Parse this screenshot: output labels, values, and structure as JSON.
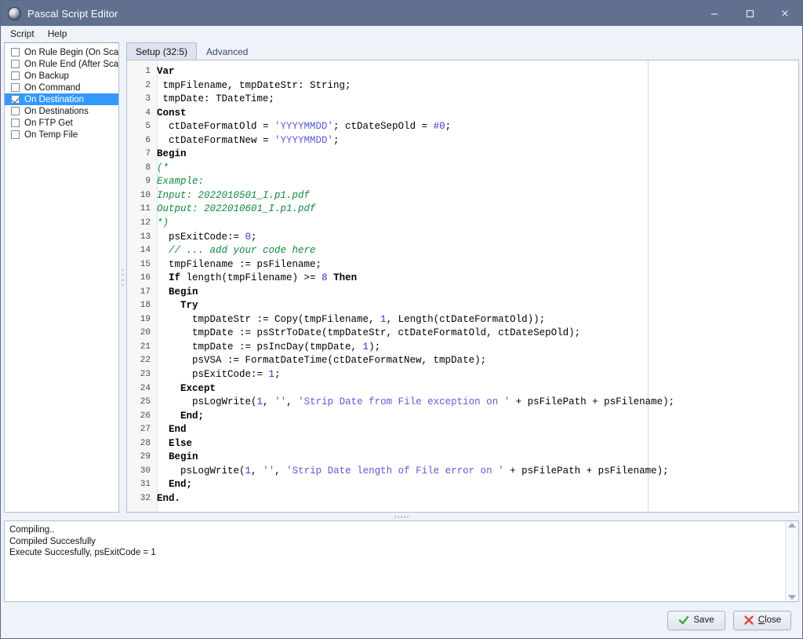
{
  "window": {
    "title": "Pascal Script Editor",
    "icon": "app-globe-icon",
    "controls": {
      "minimize": "minimize-icon",
      "maximize": "maximize-icon",
      "close": "close-icon"
    },
    "titlebar_color": "#5f718f"
  },
  "menubar": {
    "items": [
      {
        "label": "Script"
      },
      {
        "label": "Help"
      }
    ]
  },
  "sidebar": {
    "items": [
      {
        "label": "On Rule Begin (On Scan)",
        "checked": false,
        "selected": false
      },
      {
        "label": "On Rule End (After Scan)",
        "checked": false,
        "selected": false
      },
      {
        "label": "On Backup",
        "checked": false,
        "selected": false
      },
      {
        "label": "On Command",
        "checked": false,
        "selected": false
      },
      {
        "label": "On Destination",
        "checked": true,
        "selected": true
      },
      {
        "label": "On Destinations",
        "checked": false,
        "selected": false
      },
      {
        "label": "On FTP Get",
        "checked": false,
        "selected": false
      },
      {
        "label": "On Temp File",
        "checked": false,
        "selected": false
      }
    ],
    "selection_color": "#3399ff"
  },
  "tabs": [
    {
      "label": "Setup (32:5)",
      "active": true
    },
    {
      "label": "Advanced",
      "active": false
    }
  ],
  "editor": {
    "language": "pascal",
    "cursor_position": "32:5",
    "total_lines": 32,
    "colors": {
      "keyword": "#000000",
      "string": "#5b5bd6",
      "number": "#3333cc",
      "comment": "#118a3d"
    },
    "lines": [
      {
        "n": 1,
        "tokens": [
          {
            "t": "Var",
            "c": "kw"
          }
        ]
      },
      {
        "n": 2,
        "tokens": [
          {
            "t": " tmpFilename, tmpDateStr: String;",
            "c": "pln"
          }
        ]
      },
      {
        "n": 3,
        "tokens": [
          {
            "t": " tmpDate: TDateTime;",
            "c": "pln"
          }
        ]
      },
      {
        "n": 4,
        "tokens": [
          {
            "t": "Const",
            "c": "kw"
          }
        ]
      },
      {
        "n": 5,
        "tokens": [
          {
            "t": "  ctDateFormatOld = ",
            "c": "pln"
          },
          {
            "t": "'YYYYMMDD'",
            "c": "str"
          },
          {
            "t": "; ctDateSepOld = ",
            "c": "pln"
          },
          {
            "t": "#0",
            "c": "num"
          },
          {
            "t": ";",
            "c": "pln"
          }
        ]
      },
      {
        "n": 6,
        "tokens": [
          {
            "t": "  ctDateFormatNew = ",
            "c": "pln"
          },
          {
            "t": "'YYYYMMDD'",
            "c": "str"
          },
          {
            "t": ";",
            "c": "pln"
          }
        ]
      },
      {
        "n": 7,
        "tokens": [
          {
            "t": "Begin",
            "c": "kw"
          }
        ]
      },
      {
        "n": 8,
        "tokens": [
          {
            "t": "(*",
            "c": "cmt"
          }
        ]
      },
      {
        "n": 9,
        "tokens": [
          {
            "t": "Example:",
            "c": "cmt"
          }
        ]
      },
      {
        "n": 10,
        "tokens": [
          {
            "t": "Input: 2022010501_I.p1.pdf",
            "c": "cmt"
          }
        ]
      },
      {
        "n": 11,
        "tokens": [
          {
            "t": "Output: 2022010601_I.p1.pdf",
            "c": "cmt"
          }
        ]
      },
      {
        "n": 12,
        "tokens": [
          {
            "t": "*)",
            "c": "cmt"
          }
        ]
      },
      {
        "n": 13,
        "tokens": [
          {
            "t": "  psExitCode:= ",
            "c": "pln"
          },
          {
            "t": "0",
            "c": "num"
          },
          {
            "t": ";",
            "c": "pln"
          }
        ]
      },
      {
        "n": 14,
        "tokens": [
          {
            "t": "  // ... add your code here",
            "c": "cmt"
          }
        ]
      },
      {
        "n": 15,
        "tokens": [
          {
            "t": "  tmpFilename := psFilename;",
            "c": "pln"
          }
        ]
      },
      {
        "n": 16,
        "tokens": [
          {
            "t": "  ",
            "c": "pln"
          },
          {
            "t": "If",
            "c": "kw"
          },
          {
            "t": " length(tmpFilename) >= ",
            "c": "pln"
          },
          {
            "t": "8",
            "c": "num"
          },
          {
            "t": " ",
            "c": "pln"
          },
          {
            "t": "Then",
            "c": "kw"
          }
        ]
      },
      {
        "n": 17,
        "tokens": [
          {
            "t": "  ",
            "c": "pln"
          },
          {
            "t": "Begin",
            "c": "kw"
          }
        ]
      },
      {
        "n": 18,
        "tokens": [
          {
            "t": "    ",
            "c": "pln"
          },
          {
            "t": "Try",
            "c": "kw"
          }
        ]
      },
      {
        "n": 19,
        "tokens": [
          {
            "t": "      tmpDateStr := Copy(tmpFilename, ",
            "c": "pln"
          },
          {
            "t": "1",
            "c": "num"
          },
          {
            "t": ", Length(ctDateFormatOld));",
            "c": "pln"
          }
        ]
      },
      {
        "n": 20,
        "tokens": [
          {
            "t": "      tmpDate := psStrToDate(tmpDateStr, ctDateFormatOld, ctDateSepOld);",
            "c": "pln"
          }
        ]
      },
      {
        "n": 21,
        "tokens": [
          {
            "t": "      tmpDate := psIncDay(tmpDate, ",
            "c": "pln"
          },
          {
            "t": "1",
            "c": "num"
          },
          {
            "t": ");",
            "c": "pln"
          }
        ]
      },
      {
        "n": 22,
        "tokens": [
          {
            "t": "      psVSA := FormatDateTime(ctDateFormatNew, tmpDate);",
            "c": "pln"
          }
        ]
      },
      {
        "n": 23,
        "tokens": [
          {
            "t": "      psExitCode:= ",
            "c": "pln"
          },
          {
            "t": "1",
            "c": "num"
          },
          {
            "t": ";",
            "c": "pln"
          }
        ]
      },
      {
        "n": 24,
        "tokens": [
          {
            "t": "    ",
            "c": "pln"
          },
          {
            "t": "Except",
            "c": "kw"
          }
        ]
      },
      {
        "n": 25,
        "tokens": [
          {
            "t": "      psLogWrite(",
            "c": "pln"
          },
          {
            "t": "1",
            "c": "num"
          },
          {
            "t": ", ",
            "c": "pln"
          },
          {
            "t": "''",
            "c": "str"
          },
          {
            "t": ", ",
            "c": "pln"
          },
          {
            "t": "'Strip Date from File exception on '",
            "c": "str"
          },
          {
            "t": " + psFilePath + psFilename);",
            "c": "pln"
          }
        ]
      },
      {
        "n": 26,
        "tokens": [
          {
            "t": "    ",
            "c": "pln"
          },
          {
            "t": "End;",
            "c": "kw"
          }
        ]
      },
      {
        "n": 27,
        "tokens": [
          {
            "t": "  ",
            "c": "pln"
          },
          {
            "t": "End",
            "c": "kw"
          }
        ]
      },
      {
        "n": 28,
        "tokens": [
          {
            "t": "  ",
            "c": "pln"
          },
          {
            "t": "Else",
            "c": "kw"
          }
        ]
      },
      {
        "n": 29,
        "tokens": [
          {
            "t": "  ",
            "c": "pln"
          },
          {
            "t": "Begin",
            "c": "kw"
          }
        ]
      },
      {
        "n": 30,
        "tokens": [
          {
            "t": "    psLogWrite(",
            "c": "pln"
          },
          {
            "t": "1",
            "c": "num"
          },
          {
            "t": ", ",
            "c": "pln"
          },
          {
            "t": "''",
            "c": "str"
          },
          {
            "t": ", ",
            "c": "pln"
          },
          {
            "t": "'Strip Date length of File error on '",
            "c": "str"
          },
          {
            "t": " + psFilePath + psFilename);",
            "c": "pln"
          }
        ]
      },
      {
        "n": 31,
        "tokens": [
          {
            "t": "  ",
            "c": "pln"
          },
          {
            "t": "End;",
            "c": "kw"
          }
        ]
      },
      {
        "n": 32,
        "tokens": [
          {
            "t": "End.",
            "c": "kw"
          }
        ]
      }
    ]
  },
  "log": {
    "lines": [
      "Compiling..",
      "Compiled Succesfully",
      "Execute Succesfully, psExitCode = 1"
    ],
    "scroll_up": "scroll-up-arrow",
    "scroll_down": "scroll-down-arrow"
  },
  "footer": {
    "save": {
      "label": "Save",
      "icon": "check-icon",
      "icon_color": "#3aa83a"
    },
    "close": {
      "label": "Close",
      "label_prefix": "C",
      "label_rest": "lose",
      "icon": "x-icon",
      "icon_color": "#e04545"
    }
  }
}
